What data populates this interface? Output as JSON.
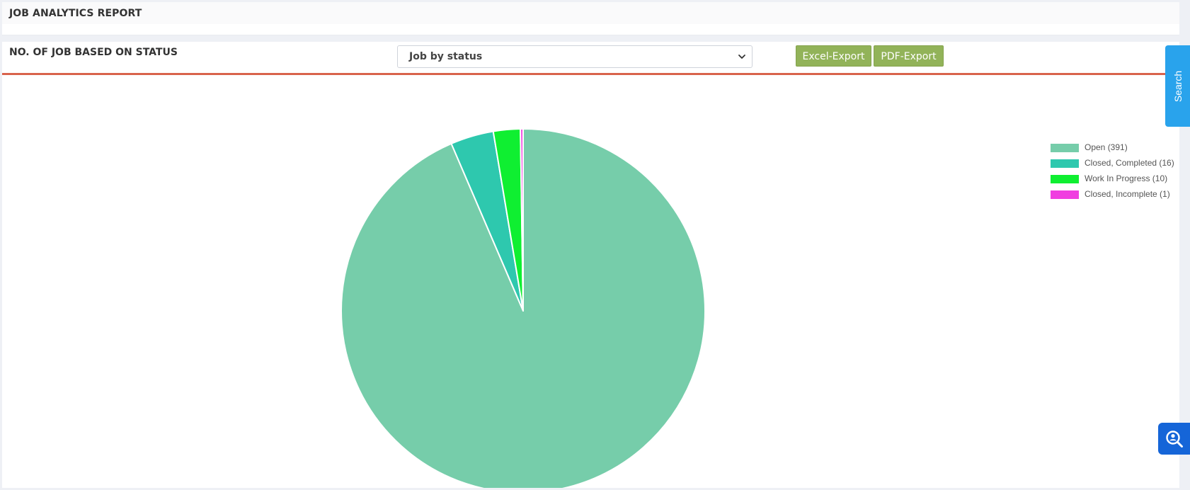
{
  "header": {
    "title": "JOB ANALYTICS REPORT"
  },
  "panel": {
    "title": "NO. OF JOB BASED ON STATUS",
    "select": {
      "value": "Job by status"
    },
    "buttons": {
      "excel": "Excel-Export",
      "pdf": "PDF-Export"
    }
  },
  "side": {
    "search_label": "Search"
  },
  "icons": {
    "select_caret": "chevron-down-icon",
    "fab": "person-search-icon"
  },
  "colors": {
    "accent_line": "#d9634c",
    "export_button": "#92b359",
    "search_tab": "#29a3ec",
    "fab": "#1565d8"
  },
  "chart_data": {
    "type": "pie",
    "categories": [
      "Open",
      "Closed, Completed",
      "Work In Progress",
      "Closed, Incomplete"
    ],
    "values": [
      391,
      16,
      10,
      1
    ],
    "colors": [
      "#76cdaa",
      "#2ec8ae",
      "#0fef31",
      "#f03ee0"
    ],
    "legend": {
      "placement": "top-right",
      "entries": [
        "Open (391)",
        "Closed, Completed (16)",
        "Work In Progress (10)",
        "Closed, Incomplete (1)"
      ]
    }
  }
}
